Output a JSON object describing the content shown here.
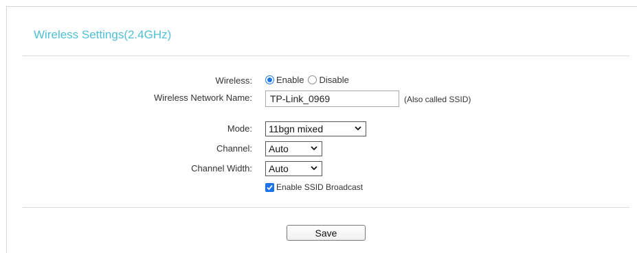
{
  "section": {
    "title": "Wireless Settings(2.4GHz)"
  },
  "wireless": {
    "label": "Wireless:",
    "options": [
      "Enable",
      "Disable"
    ],
    "selected": "Enable"
  },
  "network_name": {
    "label": "Wireless Network Name:",
    "value": "TP-Link_0969",
    "hint": "(Also called SSID)"
  },
  "mode": {
    "label": "Mode:",
    "value": "11bgn mixed"
  },
  "channel": {
    "label": "Channel:",
    "value": "Auto"
  },
  "channel_width": {
    "label": "Channel Width:",
    "value": "Auto"
  },
  "ssid_broadcast": {
    "label": "Enable SSID Broadcast",
    "checked": true
  },
  "actions": {
    "save_label": "Save"
  },
  "colors": {
    "title": "#4ec0d3",
    "accent": "#1a73e8"
  },
  "icons": {
    "select_arrow": "chevron-down-icon",
    "checkbox_mark": "checkmark-icon"
  }
}
